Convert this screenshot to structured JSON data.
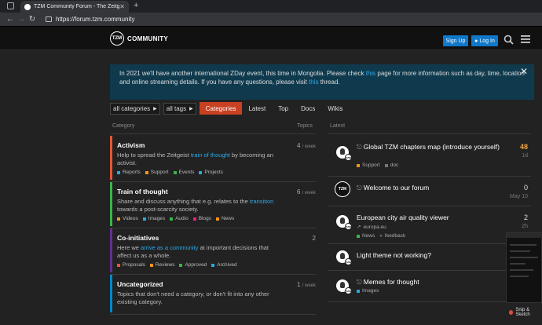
{
  "browser": {
    "tab_title": "TZM Community Forum - The Zeitgeist Movement",
    "tab_close": "✕",
    "new_tab": "+",
    "url": "https://forum.tzm.community",
    "back": "←",
    "forward": "→",
    "reload": "↻"
  },
  "header": {
    "logo_text": "TZM",
    "brand": "COMMUNITY",
    "signup": "Sign Up",
    "login": "Log In"
  },
  "banner": {
    "text_1": "In 2021 we'll have another international ZDay event, this time in Mongolia. Please check ",
    "link_1": "this",
    "text_2": " page for more information such as day, time, location and online streaming details. If you have any questions, please visit ",
    "link_2": "this",
    "text_3": " thread.",
    "close": "✕"
  },
  "nav": {
    "filter_category": "all categories",
    "filter_tags": "all tags",
    "items": [
      "Categories",
      "Latest",
      "Top",
      "Docs",
      "Wikis"
    ]
  },
  "columns": {
    "category": "Category",
    "topics": "Topics",
    "latest": "Latest"
  },
  "categories": [
    {
      "name": "Activism",
      "desc_1": "Help to spread the Zeitgeist ",
      "desc_link": "train of thought",
      "desc_2": " by becoming an activist.",
      "count": "4",
      "per": "/ week",
      "color": "#e45735",
      "subs": [
        {
          "label": "Reports",
          "color": "#25aae1"
        },
        {
          "label": "Support",
          "color": "#f7941d"
        },
        {
          "label": "Events",
          "color": "#3ab54a"
        },
        {
          "label": "Projects",
          "color": "#25aae1"
        }
      ]
    },
    {
      "name": "Train of thought",
      "desc_1": "Share and discuss anything that e.g. relates to the ",
      "desc_link": "transition",
      "desc_2": " towards a post-scarcity society.",
      "count": "6",
      "per": "/ week",
      "color": "#3ab54a",
      "subs": [
        {
          "label": "Videos",
          "color": "#f7941d"
        },
        {
          "label": "Images",
          "color": "#25aae1"
        },
        {
          "label": "Audio",
          "color": "#3ab54a"
        },
        {
          "label": "Blogs",
          "color": "#ed207b"
        },
        {
          "label": "News",
          "color": "#f7941d"
        }
      ]
    },
    {
      "name": "Co-initiatives",
      "desc_1": "Here we ",
      "desc_link": "arrive as a community",
      "desc_2": " at important decisions that affect us as a whole.",
      "count": "2",
      "per": "",
      "color": "#652d90",
      "subs": [
        {
          "label": "Proposals",
          "color": "#e45735"
        },
        {
          "label": "Reviews",
          "color": "#f7941d"
        },
        {
          "label": "Approved",
          "color": "#3ab54a"
        },
        {
          "label": "Archived",
          "color": "#25aae1"
        }
      ]
    },
    {
      "name": "Uncategorized",
      "desc_1": "Topics that don't need a category, or don't fit into any other existing category.",
      "desc_link": "",
      "desc_2": "",
      "count": "1",
      "per": "/ week",
      "color": "#0088cc",
      "subs": []
    }
  ],
  "topics": [
    {
      "title": "Global TZM chapters map (introduce yourself)",
      "pinned": true,
      "meta": [
        {
          "label": "Support",
          "color": "#f7941d"
        },
        {
          "label": "doc",
          "color": "#777777"
        }
      ],
      "replies": "48",
      "when": "1d",
      "hot": true,
      "avatar": "person"
    },
    {
      "title": "Welcome to our forum",
      "pinned": true,
      "meta": [],
      "replies": "0",
      "when": "May 10",
      "hot": false,
      "avatar": "tzm"
    },
    {
      "title": "European city air quality viewer",
      "pinned": false,
      "meta": [
        {
          "label": "europa.eu",
          "color": ""
        }
      ],
      "meta2": [
        {
          "label": "News",
          "color": "#3ab54a"
        },
        {
          "label": "feedback",
          "color": ""
        }
      ],
      "replies": "2",
      "when": "2h",
      "hot": false,
      "avatar": "person"
    },
    {
      "title": "Light theme not working?",
      "pinned": false,
      "meta": [],
      "replies": "",
      "when": "",
      "hot": false,
      "avatar": "person"
    },
    {
      "title": "Memes for thought",
      "pinned": true,
      "meta": [
        {
          "label": "Images",
          "color": "#25aae1"
        }
      ],
      "replies": "",
      "when": "",
      "hot": false,
      "avatar": "person"
    }
  ],
  "overlay": {
    "snip": "Snip & Sketch"
  }
}
